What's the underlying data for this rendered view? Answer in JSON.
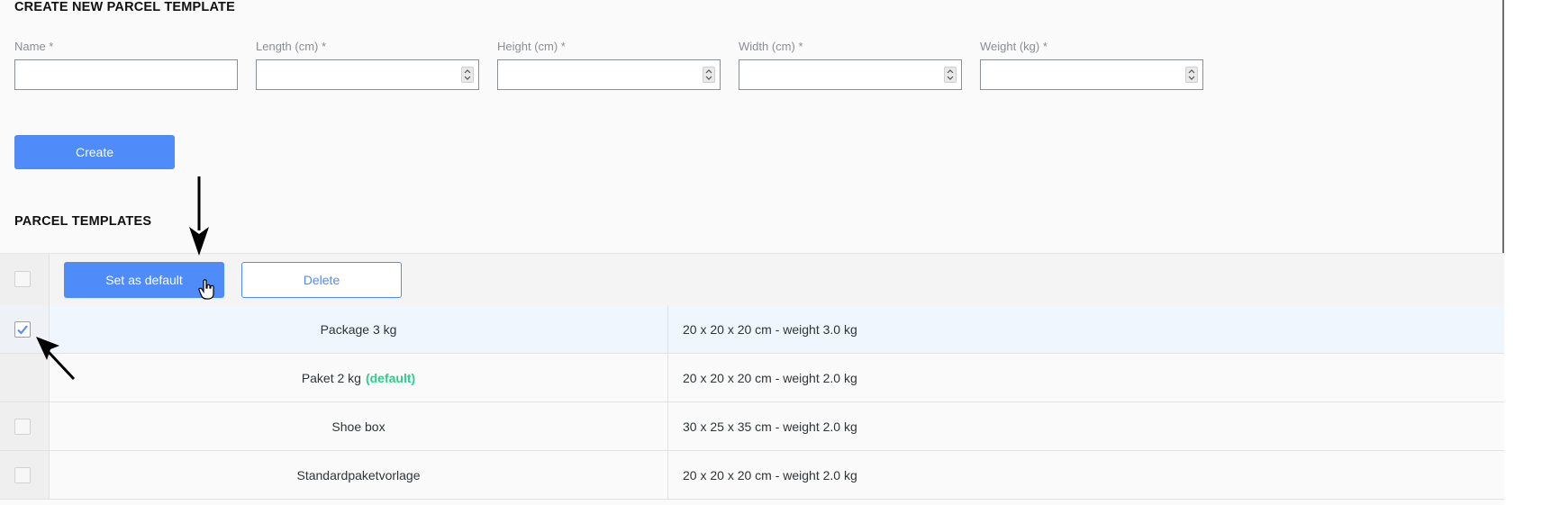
{
  "create_form": {
    "title": "CREATE NEW PARCEL TEMPLATE",
    "fields": [
      {
        "label": "Name *",
        "value": "",
        "type": "text"
      },
      {
        "label": "Length (cm) *",
        "value": "",
        "type": "number"
      },
      {
        "label": "Height (cm) *",
        "value": "",
        "type": "number"
      },
      {
        "label": "Width (cm) *",
        "value": "",
        "type": "number"
      },
      {
        "label": "Weight (kg) *",
        "value": "",
        "type": "number"
      }
    ],
    "create_label": "Create"
  },
  "templates": {
    "title": "PARCEL TEMPLATES",
    "toolbar": {
      "set_default_label": "Set as default",
      "delete_label": "Delete",
      "select_all_checked": false
    },
    "rows": [
      {
        "name": "Package 3 kg",
        "tag": "",
        "dims": "20 x 20 x 20 cm - weight 3.0 kg",
        "checked": true,
        "has_checkbox": true
      },
      {
        "name": "Paket 2 kg",
        "tag": "(default)",
        "dims": "20 x 20 x 20 cm - weight 2.0 kg",
        "checked": false,
        "has_checkbox": false
      },
      {
        "name": "Shoe box",
        "tag": "",
        "dims": "30 x 25 x 35 cm - weight 2.0 kg",
        "checked": false,
        "has_checkbox": true
      },
      {
        "name": "Standardpaketvorlage",
        "tag": "",
        "dims": "20 x 20 x 20 cm - weight 2.0 kg",
        "checked": false,
        "has_checkbox": true
      }
    ]
  },
  "colors": {
    "accent": "#4f8bf9",
    "default_tag": "#2ccf8e",
    "selected_row": "#f0f6fd"
  },
  "icons": [
    "chevron-spinner-icon",
    "checkmark-icon",
    "hand-cursor-icon",
    "arrow-down-annotation",
    "arrow-up-left-annotation"
  ]
}
